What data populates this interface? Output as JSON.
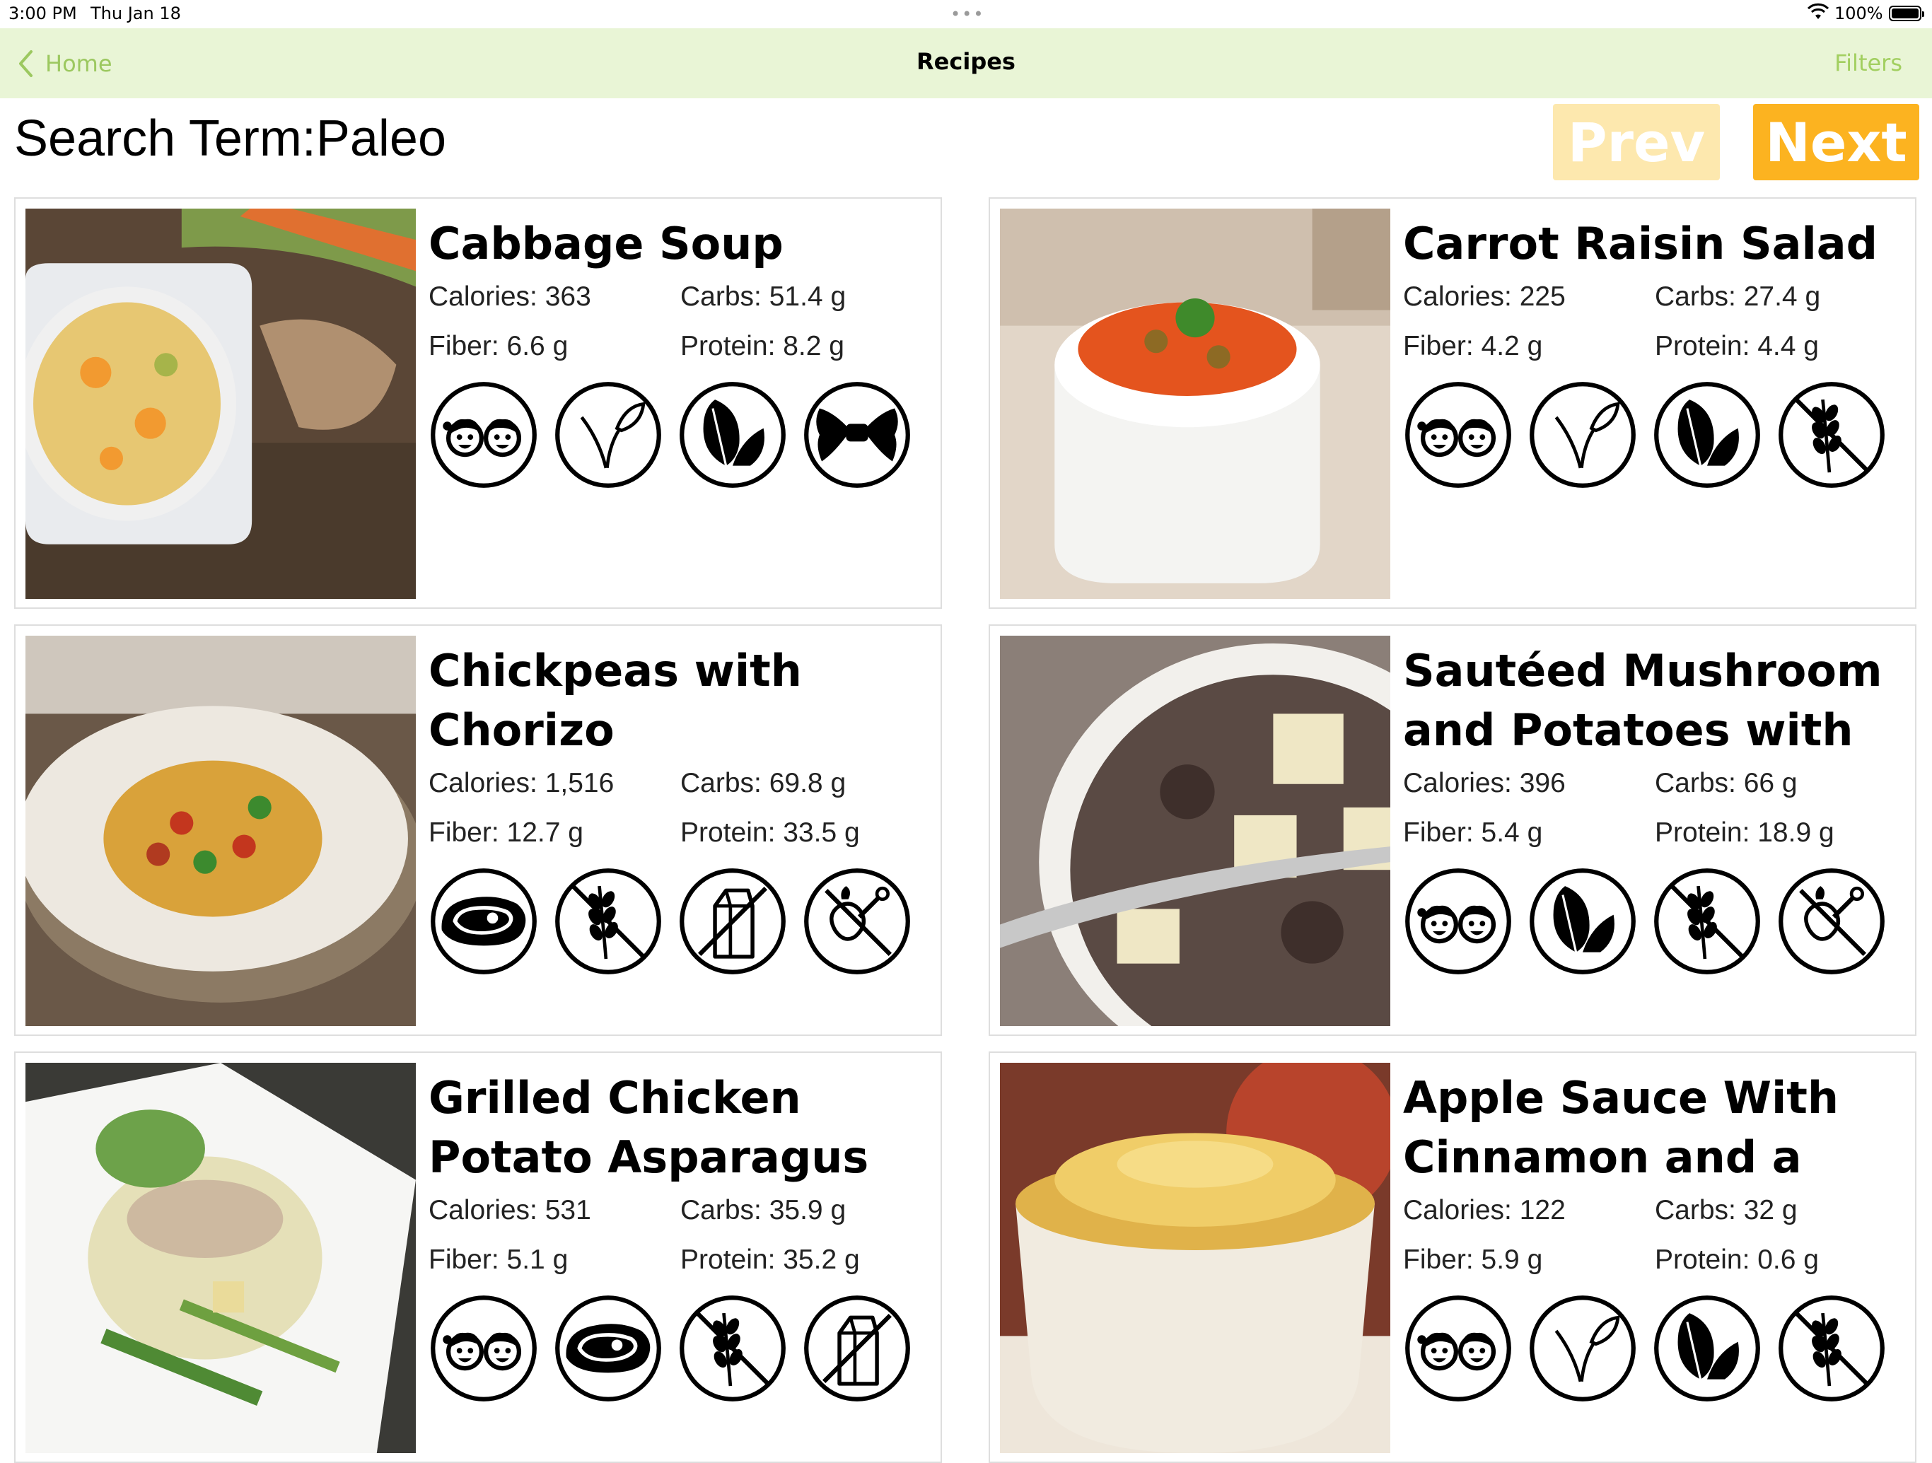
{
  "status_bar": {
    "time": "3:00 PM",
    "date": "Thu Jan 18",
    "battery": "100%"
  },
  "nav": {
    "back_label": "Home",
    "title": "Recipes",
    "filters_label": "Filters",
    "accent_color": "#9cc860",
    "bar_color": "#e9f5d6"
  },
  "search": {
    "label": "Search Term:",
    "term": "Paleo"
  },
  "pager": {
    "prev_label": "Prev",
    "next_label": "Next",
    "prev_color": "#fde8ae",
    "next_color": "#fcb320"
  },
  "recipes": [
    {
      "name": "Cabbage Soup",
      "calories": "Calories: 363",
      "carbs": "Carbs: 51.4 g",
      "fiber": "Fiber: 6.6 g",
      "protein": "Protein: 8.2 g",
      "photo": "soup",
      "icons": [
        "kid-friendly-icon",
        "vegan-icon",
        "vegetarian-icon",
        "pasta-icon"
      ]
    },
    {
      "name": "Carrot Raisin Salad",
      "calories": "Calories: 225",
      "carbs": "Carbs: 27.4 g",
      "fiber": "Fiber: 4.2 g",
      "protein": "Protein: 4.4 g",
      "photo": "carrot",
      "icons": [
        "kid-friendly-icon",
        "vegan-icon",
        "vegetarian-icon",
        "gluten-free-icon"
      ]
    },
    {
      "name": "Chickpeas with Chorizo",
      "calories": "Calories: 1,516",
      "carbs": "Carbs: 69.8 g",
      "fiber": "Fiber: 12.7 g",
      "protein": "Protein: 33.5 g",
      "photo": "chickpea",
      "icons": [
        "meat-icon",
        "gluten-free-icon",
        "dairy-icon",
        "poultry-free-icon"
      ]
    },
    {
      "name": "Sautéed Mushroom and Potatoes with Dill",
      "calories": "Calories: 396",
      "carbs": "Carbs: 66 g",
      "fiber": "Fiber: 5.4 g",
      "protein": "Protein: 18.9 g",
      "photo": "mushroom",
      "icons": [
        "kid-friendly-icon",
        "vegetarian-icon",
        "gluten-free-icon",
        "poultry-free-icon"
      ]
    },
    {
      "name": "Grilled Chicken Potato Asparagus Salad",
      "calories": "Calories: 531",
      "carbs": "Carbs: 35.9 g",
      "fiber": "Fiber: 5.1 g",
      "protein": "Protein: 35.2 g",
      "photo": "chicken",
      "icons": [
        "kid-friendly-icon",
        "meat-icon",
        "gluten-free-icon",
        "dairy-icon"
      ]
    },
    {
      "name": "Apple Sauce With Cinnamon and a Bosc…",
      "calories": "Calories: 122",
      "carbs": "Carbs: 32 g",
      "fiber": "Fiber: 5.9 g",
      "protein": "Protein: 0.6 g",
      "photo": "applesauce",
      "icons": [
        "kid-friendly-icon",
        "vegan-icon",
        "vegetarian-icon",
        "gluten-free-icon"
      ]
    }
  ]
}
